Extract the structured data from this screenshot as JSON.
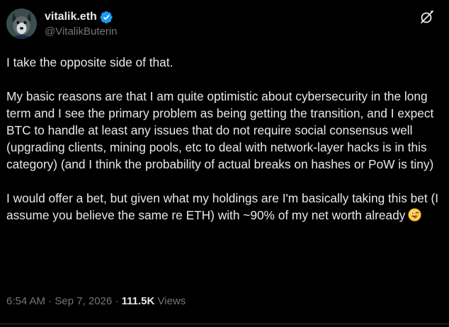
{
  "author": {
    "display_name": "vitalik.eth",
    "handle": "@VitalikButerin",
    "verified": true,
    "avatar_icon": "wolf-avatar-icon"
  },
  "tweet": {
    "paragraphs": [
      "I take the opposite side of that.",
      "My basic reasons are that I am quite optimistic about cybersecurity in the long term and I see the primary problem as being getting the transition, and I expect BTC to handle at least any issues that do not require social consensus well (upgrading clients, mining pools, etc to deal with network-layer hacks is in this category) (and I think the probability of actual breaks on hashes or PoW is tiny)",
      "I would offer a bet, but given what my holdings are I'm basically taking this bet (I assume you believe the same re ETH) with ~90% of my net worth already"
    ],
    "trailing_emoji": "😜"
  },
  "meta": {
    "time": "6:54 AM",
    "separator": "·",
    "date": "Sep 7, 2026",
    "views_count": "111.5K",
    "views_label": "Views"
  },
  "icons": {
    "verified": "verified-badge-icon",
    "grok": "grok-icon"
  },
  "colors": {
    "background": "#000000",
    "text_primary": "#e7e9ea",
    "text_secondary": "#71767b",
    "verified_blue": "#1d9bf0",
    "divider": "#2f3336"
  }
}
